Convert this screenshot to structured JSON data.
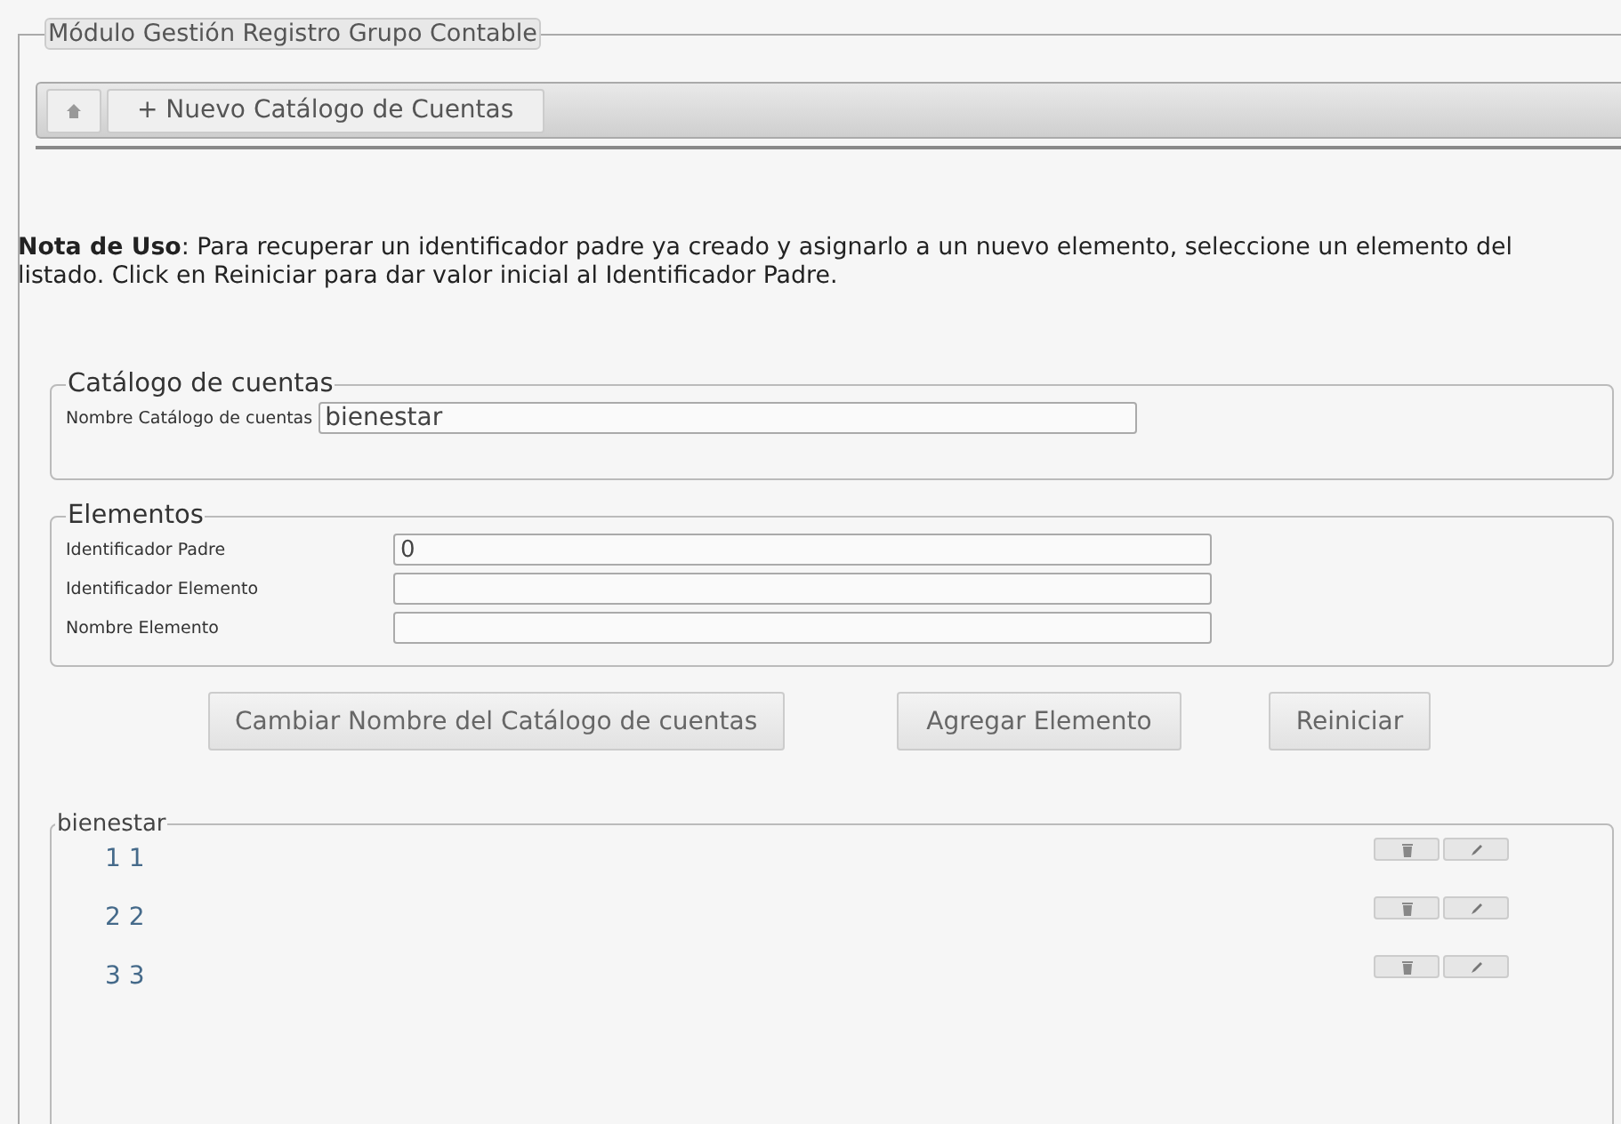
{
  "module": {
    "title": "Módulo Gestión Registro Grupo Contable"
  },
  "toolbar": {
    "tabs": [
      {
        "kind": "home",
        "selected": false
      },
      {
        "kind": "text",
        "label": "+ Nuevo Catálogo de Cuentas",
        "selected": false
      }
    ]
  },
  "note": {
    "text": "**Nota de Uso**: Para recuperar un identificador padre ya creado y asignarlo a un nuevo elemento, seleccione un elemento del listado. Click en Reiniciar para dar valor inicial al Identificador Padre."
  },
  "catalog_section": {
    "title": "Catálogo de cuentas",
    "fields": [
      {
        "label": "Nombre Catálogo de cuentas",
        "value": "bienestar"
      }
    ]
  },
  "elements_section": {
    "title": "Elementos",
    "fields": [
      {
        "label": "Identificador Padre",
        "value": "0"
      },
      {
        "label": "Identificador Elemento"
      },
      {
        "label": "Nombre Elemento"
      }
    ]
  },
  "buttons": [
    "Cambiar Nombre del Catálogo de cuentas",
    "Agregar Elemento",
    "Reiniciar"
  ],
  "list": {
    "title": "bienestar",
    "items": [
      {
        "label": "1 1"
      },
      {
        "label": "2 2"
      },
      {
        "label": "3 3"
      }
    ]
  }
}
